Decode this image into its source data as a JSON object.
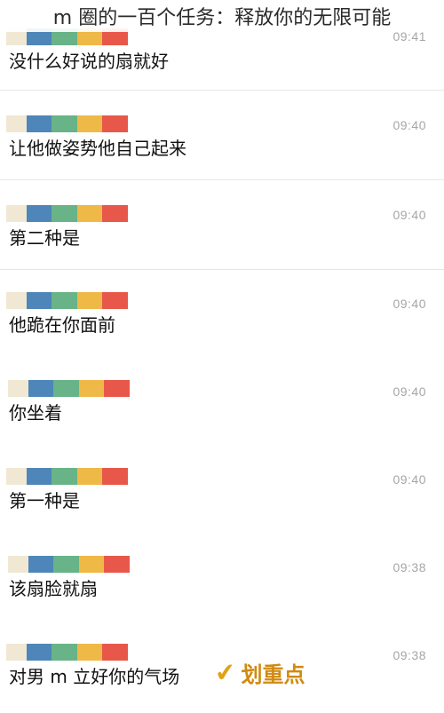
{
  "page": {
    "title": "m 圈的一百个任务：释放你的无限可能"
  },
  "palette": {
    "name_bar": [
      "#f0e8d3",
      "#4f86b9",
      "#68b387",
      "#efb947",
      "#e8584a"
    ],
    "time_text": "#a6a6a6",
    "divider": "#e7e7e7",
    "highlight": "#d18a10"
  },
  "messages": [
    {
      "time": "09:41",
      "text": "没什么好说的扇就好"
    },
    {
      "time": "09:40",
      "text": "让他做姿势他自己起来"
    },
    {
      "time": "09:40",
      "text": "第二种是"
    },
    {
      "time": "09:40",
      "text": "他跪在你面前"
    },
    {
      "time": "09:40",
      "text": "你坐着"
    },
    {
      "time": "09:40",
      "text": "第一种是"
    },
    {
      "time": "09:38",
      "text": "该扇脸就扇"
    },
    {
      "time": "09:38",
      "text": "对男 m 立好你的气场"
    }
  ],
  "highlight": {
    "icon": "checkmark-icon",
    "label": "划重点"
  }
}
